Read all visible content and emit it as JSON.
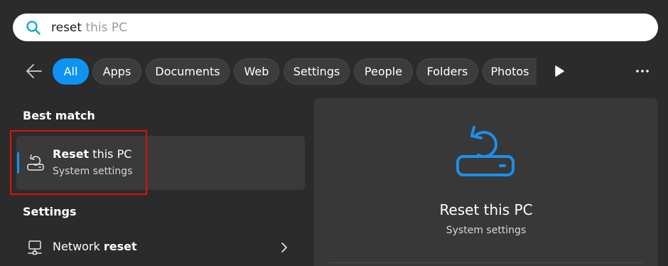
{
  "search": {
    "typed": "reset",
    "suggestion": " this PC"
  },
  "filters": [
    {
      "label": "All",
      "active": true
    },
    {
      "label": "Apps"
    },
    {
      "label": "Documents"
    },
    {
      "label": "Web"
    },
    {
      "label": "Settings"
    },
    {
      "label": "People"
    },
    {
      "label": "Folders"
    },
    {
      "label": "Photos"
    }
  ],
  "best_match": {
    "heading": "Best match",
    "item": {
      "title_bold": "Reset",
      "title_rest": " this PC",
      "subtitle": "System settings",
      "icon": "reset-pc-icon"
    }
  },
  "settings_section": {
    "heading": "Settings",
    "items": [
      {
        "label_plain": "Network ",
        "label_bold": "reset",
        "icon": "network-icon"
      }
    ]
  },
  "preview": {
    "title": "Reset this PC",
    "subtitle": "System settings",
    "icon": "reset-pc-icon"
  },
  "colors": {
    "accent": "#0f93f3",
    "icon_blue": "#1d8fe8",
    "highlight": "#e01010",
    "background": "#2b2b2b"
  }
}
